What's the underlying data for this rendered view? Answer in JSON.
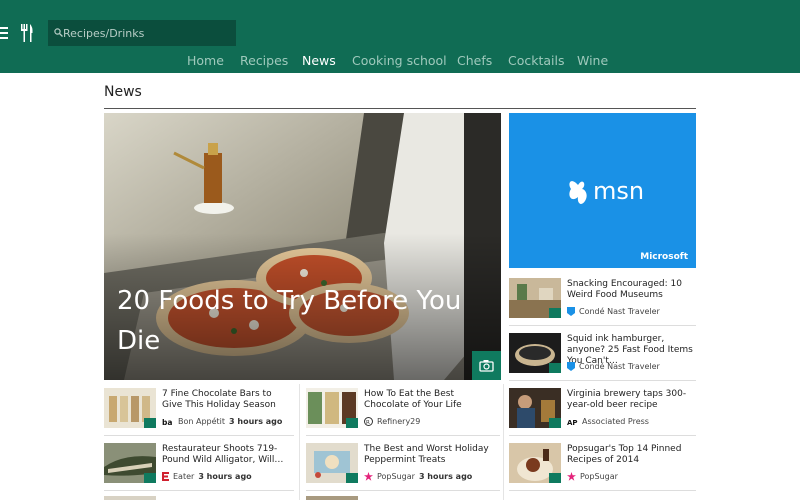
{
  "search": {
    "placeholder": "Recipes/Drinks"
  },
  "nav": [
    "Home",
    "Recipes",
    "News",
    "Cooking school",
    "Chefs",
    "Cocktails",
    "Wine"
  ],
  "nav_active": "News",
  "section_title": "News",
  "hero": {
    "title": "20 Foods to Try Before You Die"
  },
  "ad": {
    "brand": "msn",
    "company": "Microsoft"
  },
  "right_items": [
    {
      "title": "Snacking Encouraged: 10 Weird Food Museums",
      "source": "Condé Nast Traveler"
    },
    {
      "title": "Squid ink hamburger, anyone? 25 Fast Food Items You Can't…",
      "source": "Condé Nast Traveler"
    },
    {
      "title": "Virginia brewery taps 300-year-old beer recipe",
      "source": "Associated Press"
    },
    {
      "title": "Popsugar's Top 14 Pinned Recipes of 2014",
      "source": "PopSugar"
    }
  ],
  "left_items": [
    {
      "title": "7 Fine Chocolate Bars to Give This Holiday Season",
      "source": "Bon Appétit",
      "time": "3 hours ago"
    },
    {
      "title": "Restaurateur Shoots 719-Pound Wild Alligator, Will…",
      "source": "Eater",
      "time": "3 hours ago"
    }
  ],
  "mid_items": [
    {
      "title": "How To Eat the Best Chocolate of Your Life",
      "source": "Refinery29"
    },
    {
      "title": "The Best and Worst Holiday Peppermint Treats",
      "source": "PopSugar",
      "time": "3 hours ago"
    }
  ],
  "colors": {
    "header": "#106c54",
    "accent": "#0f7a5f",
    "msn_blue": "#1a91e6"
  }
}
